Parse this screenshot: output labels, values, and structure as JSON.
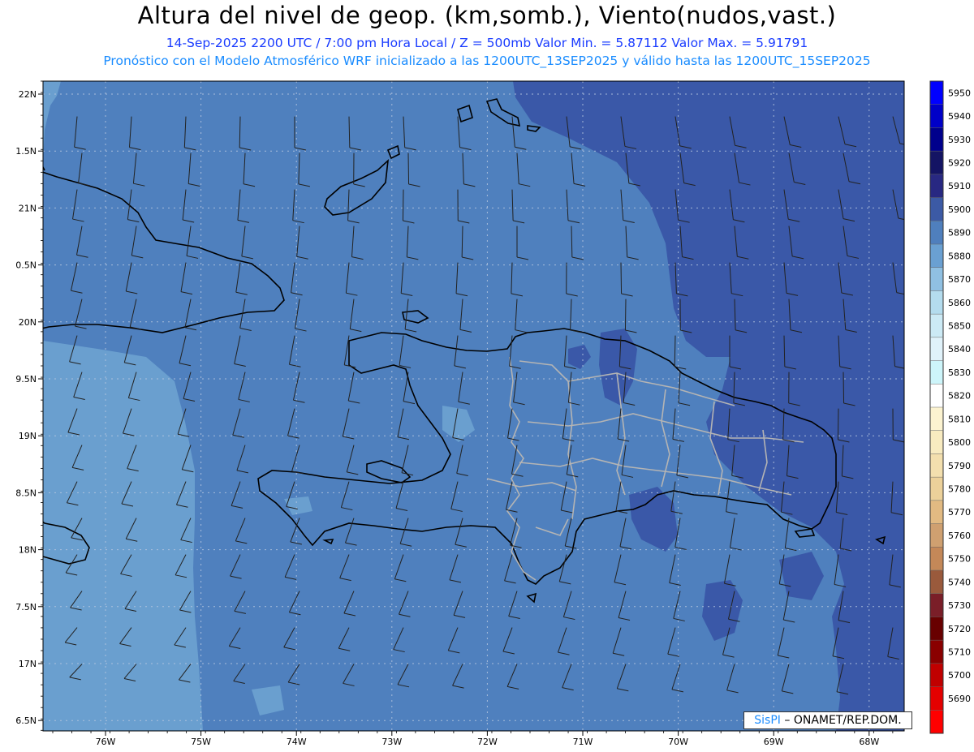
{
  "header": {
    "title": "Altura del nivel de geop. (km,somb.), Viento(nudos,vast.)",
    "subtitle_line1": "14-Sep-2025  2200 UTC / 7:00 pm Hora Local / Z = 500mb    Valor Min. = 5.87112  Valor Max. = 5.91791",
    "subtitle_line2": "Pronóstico con el Modelo Atmosférico WRF inicializado a las 1200UTC_13SEP2025 y válido hasta las  1200UTC_15SEP2025"
  },
  "map": {
    "lat_labels": [
      "22N",
      "1.5N",
      "21N",
      "0.5N",
      "20N",
      "9.5N",
      "19N",
      "8.5N",
      "18N",
      "7.5N",
      "17N",
      "6.5N"
    ],
    "lon_labels": [
      "76W",
      "75W",
      "74W",
      "73W",
      "72W",
      "71W",
      "70W",
      "69W",
      "68W"
    ],
    "field_colors": {
      "z5880": "#6a9fcf",
      "z5890": "#4f80be",
      "z5900": "#3a58a8"
    }
  },
  "colorbar": {
    "levels": [
      "5950",
      "5940",
      "5930",
      "5920",
      "5910",
      "5900",
      "5890",
      "5880",
      "5870",
      "5860",
      "5850",
      "5840",
      "5830",
      "5820",
      "5810",
      "5800",
      "5790",
      "5780",
      "5770",
      "5760",
      "5750",
      "5740",
      "5730",
      "5720",
      "5710",
      "5700",
      "5690"
    ],
    "colors": [
      "#0000ff",
      "#0000c8",
      "#00008c",
      "#141464",
      "#282882",
      "#3c5aa5",
      "#4f7fbd",
      "#6aa0d2",
      "#90c0e2",
      "#b4dcee",
      "#cceaf5",
      "#e0f2fa",
      "#cdf5fa",
      "#ffffff",
      "#fcf3d0",
      "#f8ebc0",
      "#f3dfae",
      "#ecd19a",
      "#e2ba82",
      "#cfa070",
      "#c48858",
      "#9a5a3c",
      "#7a1e28",
      "#680000",
      "#8a0000",
      "#c00000",
      "#e40000",
      "#ff0000"
    ]
  },
  "credit": {
    "brand": "SisPI",
    "text": " – ONAMET/REP.DOM."
  }
}
